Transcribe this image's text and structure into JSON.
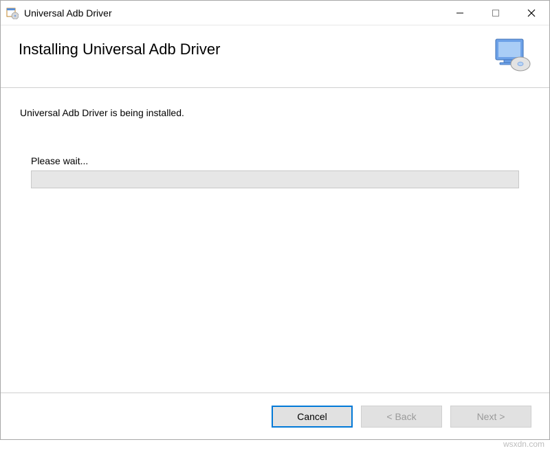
{
  "window": {
    "title": "Universal Adb Driver"
  },
  "header": {
    "title": "Installing Universal Adb Driver"
  },
  "content": {
    "status": "Universal Adb Driver is being installed.",
    "wait": "Please wait..."
  },
  "footer": {
    "cancel": "Cancel",
    "back": "< Back",
    "next": "Next >"
  },
  "watermark": "wsxdn.com"
}
